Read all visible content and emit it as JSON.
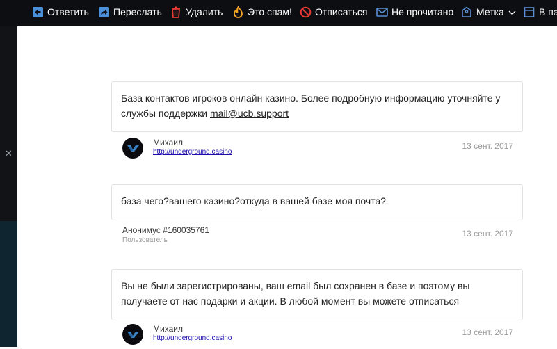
{
  "toolbar": {
    "reply": "Ответить",
    "forward": "Переслать",
    "delete": "Удалить",
    "spam": "Это спам!",
    "unsubscribe": "Отписаться",
    "unread": "Не прочитано",
    "label": "Метка",
    "folder": "В па"
  },
  "comments": [
    {
      "text": "База контактов игроков онлайн казино. Более подробную информацию уточняйте у службы поддержки ",
      "link": "mail@ucb.support",
      "author": "Михаил",
      "site": "http://underground.casino",
      "date": "13 сент. 2017"
    },
    {
      "text": "база чего?вашего казино?откуда в вашей базе моя почта?",
      "author": "Анонимус #160035761",
      "role": "Пользователь",
      "date": "13 сент. 2017"
    },
    {
      "text": "Вы не были зарегистрированы, ваш email был сохранен в базе и поэтому вы получаете от нас подарки и акции. В любой момент вы можете отписаться",
      "author": "Михаил",
      "site": "http://underground.casino",
      "date": "13 сент. 2017"
    }
  ],
  "colors": {
    "toolbar_bg": "#0d0e12",
    "reply_icon": "#4a90d9",
    "delete_icon": "#e53935",
    "spam_icon": "#f5a623",
    "unsubscribe_icon": "#e53935",
    "link": "#1a0dab"
  }
}
